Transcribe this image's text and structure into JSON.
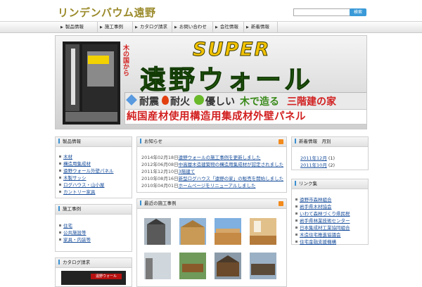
{
  "site": {
    "title": "リンデンバウム遠野"
  },
  "search": {
    "placeholder": "",
    "button_label": "検索"
  },
  "nav": [
    {
      "label": "製品情報"
    },
    {
      "label": "施工事例"
    },
    {
      "label": "カタログ請求"
    },
    {
      "label": "お問い合わせ"
    },
    {
      "label": "会社情報"
    },
    {
      "label": "新着情報"
    }
  ],
  "banner": {
    "headline": "SUPER",
    "title": "遠野ウォール",
    "tagline_parts": [
      "耐震",
      "耐火",
      "優しい",
      "木で造る",
      "三階建の家"
    ],
    "subline": "純国産材使用構造用集成材外壁パネル",
    "side_sticker": "木の国から",
    "colors": {
      "green": "#3a8a1a",
      "red": "#d22020",
      "brand": "#2b6a12"
    }
  },
  "left_boxes": [
    {
      "title": "製品情報",
      "links": [
        "木材",
        "構造用集成材",
        "遠野ウォール外壁パネル",
        "木製サッシ",
        "ログハウス・山小屋",
        "カントリー家具"
      ]
    },
    {
      "title": "施工事例",
      "links": [
        "住宅",
        "公共施設等",
        "家具・内装等"
      ]
    },
    {
      "title": "カタログ請求",
      "links": []
    }
  ],
  "news": {
    "title": "お知らせ",
    "items": [
      {
        "date": "2014年02月18日",
        "text": "遠野ウォールの施工事例を更新しました"
      },
      {
        "date": "2012年06月08日",
        "text": "中高層木造建築物の構造用集成材が認定されました"
      },
      {
        "date": "2011年12月10日",
        "text": "3階建て"
      },
      {
        "date": "2010年08月16日",
        "text": "新型ログハウス「遠野の家」の販売を開始しました"
      },
      {
        "date": "2010年04月01日",
        "text": "ホームページをリニューアルしました"
      }
    ]
  },
  "recent_works": {
    "title": "最近の施工事例"
  },
  "archive": {
    "title": "新着情報　月別",
    "items": [
      {
        "label": "2011年12月",
        "count": "(1)"
      },
      {
        "label": "2011年10月",
        "count": "(2)"
      }
    ]
  },
  "links_box": {
    "title": "リンク集",
    "links": [
      "遠野市森林組合",
      "岩手県木材協会",
      "いわて森林づくり県民税",
      "岩手県林業技術センター",
      "日本集成材工業協同組合",
      "木造住宅推進協議会",
      "住宅金融支援機構"
    ]
  },
  "catalog_teaser": {
    "text": "遠野ウォール"
  }
}
